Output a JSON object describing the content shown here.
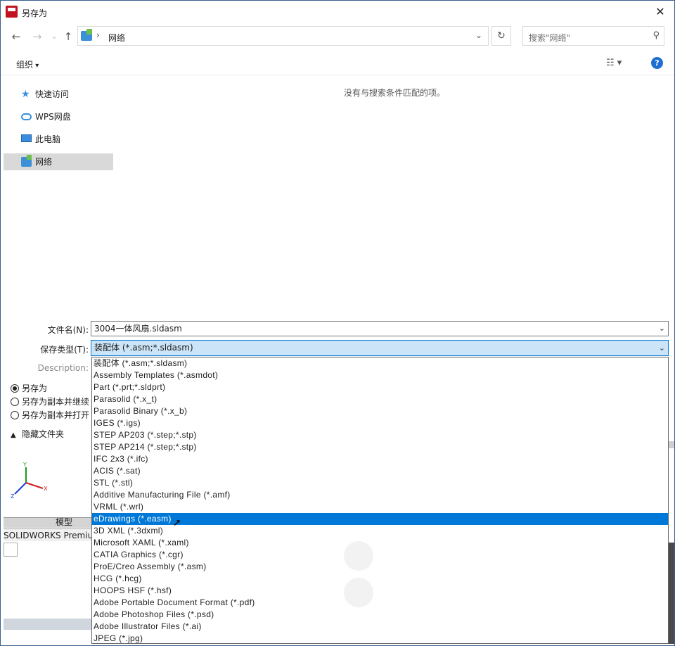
{
  "window": {
    "title": "另存为",
    "close_glyph": "✕"
  },
  "nav": {
    "back": "←",
    "forward": "→",
    "recent": "⌄",
    "up": "↑",
    "address_sep": "›",
    "address": "网络",
    "refresh": "↻",
    "search_placeholder": "搜索\"网络\""
  },
  "toolbar": {
    "organize": "组织",
    "help": "?"
  },
  "sidebar": {
    "items": [
      {
        "label": "快速访问",
        "icon": "star-icon"
      },
      {
        "label": "WPS网盘",
        "icon": "cloud-icon"
      },
      {
        "label": "此电脑",
        "icon": "computer-icon"
      },
      {
        "label": "网络",
        "icon": "network-icon",
        "selected": true
      }
    ]
  },
  "content": {
    "empty_message": "没有与搜索条件匹配的项。"
  },
  "form": {
    "filename_label": "文件名(N):",
    "filename_value": "3004一体风扇.sldasm",
    "filetype_label": "保存类型(T):",
    "filetype_value": "装配体 (*.asm;*.sldasm)",
    "description_label": "Description:",
    "radios": [
      {
        "label": "另存为",
        "checked": true
      },
      {
        "label": "另存为副本并继续",
        "checked": false
      },
      {
        "label": "另存为副本并打开",
        "checked": false
      }
    ],
    "hide_folders": "隐藏文件夹"
  },
  "filetype_options": [
    "装配体 (*.asm;*.sldasm)",
    "Assembly Templates (*.asmdot)",
    "Part (*.prt;*.sldprt)",
    "Parasolid (*.x_t)",
    "Parasolid Binary (*.x_b)",
    "IGES (*.igs)",
    "STEP AP203 (*.step;*.stp)",
    "STEP AP214 (*.step;*.stp)",
    "IFC 2x3 (*.ifc)",
    "ACIS (*.sat)",
    "STL (*.stl)",
    "Additive Manufacturing File (*.amf)",
    "VRML (*.wrl)",
    "eDrawings (*.easm)",
    "3D XML (*.3dxml)",
    "Microsoft XAML (*.xaml)",
    "CATIA Graphics (*.cgr)",
    "ProE/Creo Assembly (*.asm)",
    "HCG (*.hcg)",
    "HOOPS HSF (*.hsf)",
    "Adobe Portable Document Format (*.pdf)",
    "Adobe Photoshop Files  (*.psd)",
    "Adobe Illustrator Files (*.ai)",
    "JPEG (*.jpg)"
  ],
  "highlighted_option_index": 13,
  "background": {
    "tab_model": "模型",
    "status_text": "SOLIDWORKS Premium"
  },
  "colors": {
    "accent": "#0078d7",
    "selection": "#cce4f7",
    "help": "#1f6fd0"
  }
}
